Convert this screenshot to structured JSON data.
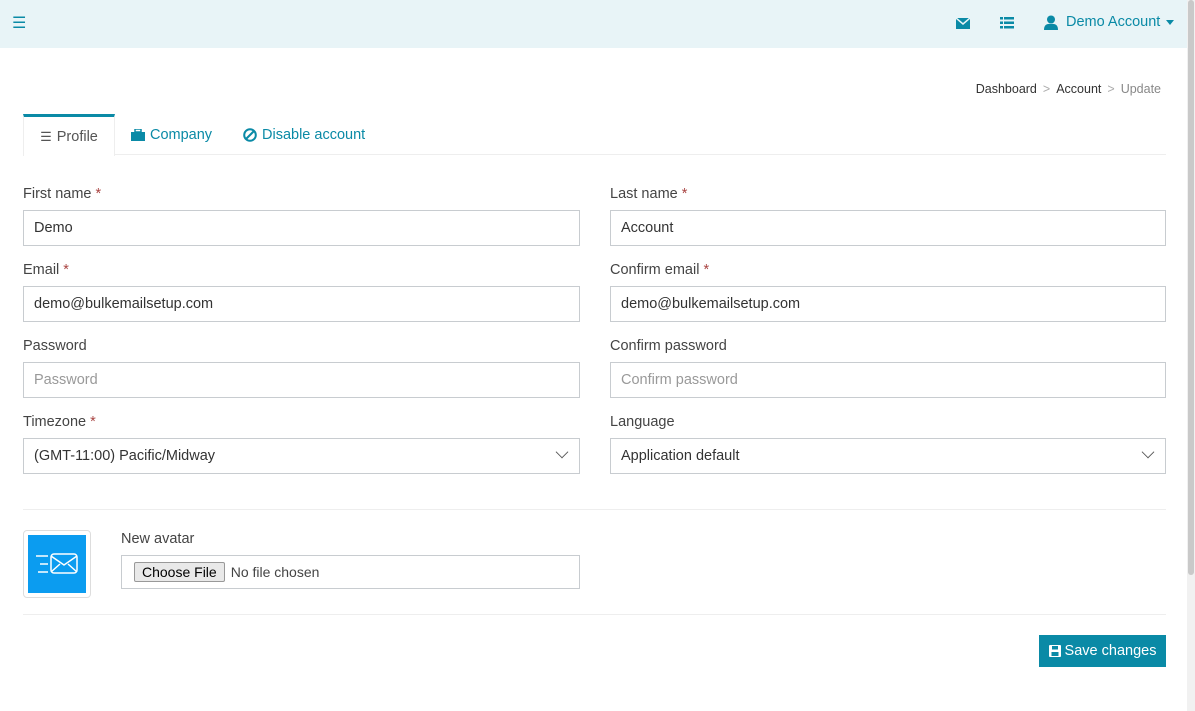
{
  "header": {
    "menu_icon": "hamburger-icon",
    "icons": [
      "envelope-icon",
      "list-icon"
    ],
    "user_label": "Demo Account"
  },
  "breadcrumb": [
    "Dashboard",
    "Account",
    "Update"
  ],
  "tabs": [
    {
      "label": "Profile",
      "icon": "list-icon"
    },
    {
      "label": "Company",
      "icon": "briefcase-icon"
    },
    {
      "label": "Disable account",
      "icon": "ban-icon"
    }
  ],
  "form": {
    "first_name": {
      "label": "First name",
      "required": "*",
      "value": "Demo"
    },
    "last_name": {
      "label": "Last name",
      "required": "*",
      "value": "Account"
    },
    "email": {
      "label": "Email",
      "required": "*",
      "value": "demo@bulkemailsetup.com"
    },
    "confirm_email": {
      "label": "Confirm email",
      "required": "*",
      "value": "demo@bulkemailsetup.com"
    },
    "password": {
      "label": "Password",
      "placeholder": "Password"
    },
    "confirm_password": {
      "label": "Confirm password",
      "placeholder": "Confirm password"
    },
    "timezone": {
      "label": "Timezone",
      "required": "*",
      "value": "(GMT-11:00) Pacific/Midway"
    },
    "language": {
      "label": "Language",
      "value": "Application default"
    },
    "avatar": {
      "label": "New avatar",
      "button": "Choose File",
      "status": "No file chosen"
    }
  },
  "save_label": "Save changes",
  "colors": {
    "accent": "#0a8aa6",
    "header_bg": "#e8f4f7",
    "avatar_bg": "#0b9cf0"
  }
}
